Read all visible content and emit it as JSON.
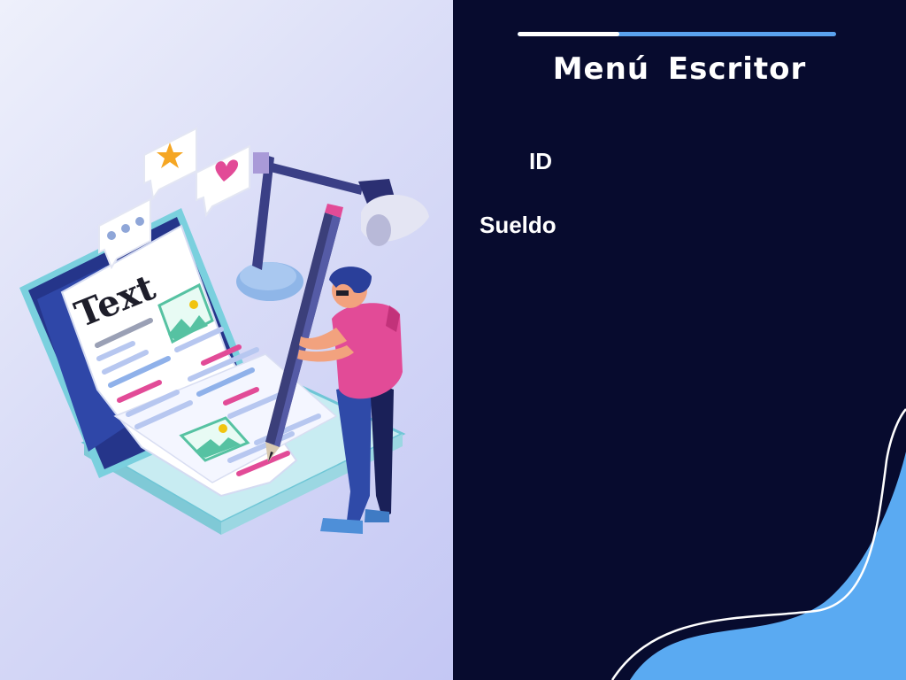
{
  "illustration": {
    "text_label": "Text",
    "icons": [
      "star-icon",
      "heart-icon",
      "ellipsis-icon",
      "image-icon",
      "desk-lamp-icon",
      "pencil-icon"
    ]
  },
  "panel": {
    "title": "Menú Escritor",
    "progress_fraction": 0.32,
    "fields": [
      {
        "label": "ID"
      },
      {
        "label": "Sueldo"
      }
    ]
  },
  "colors": {
    "panel_background": "#070b2e",
    "accent_blue": "#5aa2ee",
    "text": "#ffffff"
  }
}
